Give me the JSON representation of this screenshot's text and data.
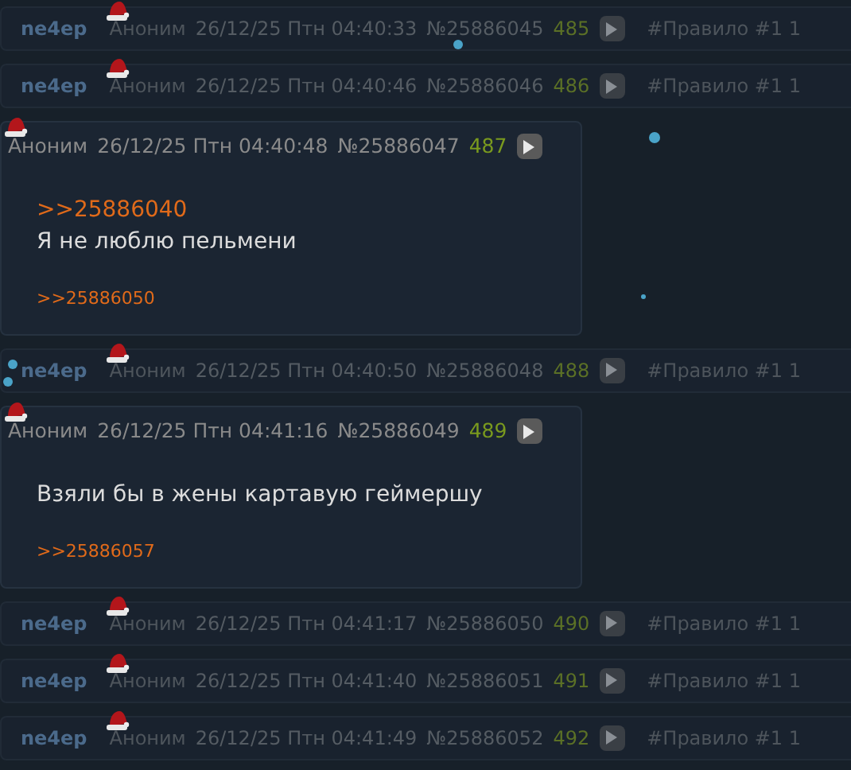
{
  "posts": [
    {
      "kind": "hidden",
      "label": "ne4ep",
      "author": "Аноним",
      "date": "26/12/25 Птн 04:40:33",
      "number": "№25886045",
      "index": "485",
      "tag": "#Правило #1 1"
    },
    {
      "kind": "hidden",
      "label": "ne4ep",
      "author": "Аноним",
      "date": "26/12/25 Птн 04:40:46",
      "number": "№25886046",
      "index": "486",
      "tag": "#Правило #1 1"
    },
    {
      "kind": "open",
      "author": "Аноним",
      "date": "26/12/25 Птн 04:40:48",
      "number": "№25886047",
      "index": "487",
      "quote": ">>25886040",
      "text": "Я не люблю пельмени",
      "replies": [
        ">>25886050"
      ]
    },
    {
      "kind": "hidden",
      "label": "ne4ep",
      "author": "Аноним",
      "date": "26/12/25 Птн 04:40:50",
      "number": "№25886048",
      "index": "488",
      "tag": "#Правило #1 1"
    },
    {
      "kind": "open",
      "author": "Аноним",
      "date": "26/12/25 Птн 04:41:16",
      "number": "№25886049",
      "index": "489",
      "text": "Взяли бы в жены картавую геймершу",
      "replies": [
        ">>25886057"
      ]
    },
    {
      "kind": "hidden",
      "label": "ne4ep",
      "author": "Аноним",
      "date": "26/12/25 Птн 04:41:17",
      "number": "№25886050",
      "index": "490",
      "tag": "#Правило #1 1"
    },
    {
      "kind": "hidden",
      "label": "ne4ep",
      "author": "Аноним",
      "date": "26/12/25 Птн 04:41:40",
      "number": "№25886051",
      "index": "491",
      "tag": "#Правило #1 1"
    },
    {
      "kind": "hidden",
      "label": "ne4ep",
      "author": "Аноним",
      "date": "26/12/25 Птн 04:41:49",
      "number": "№25886052",
      "index": "492",
      "tag": "#Правило #1 1"
    }
  ]
}
